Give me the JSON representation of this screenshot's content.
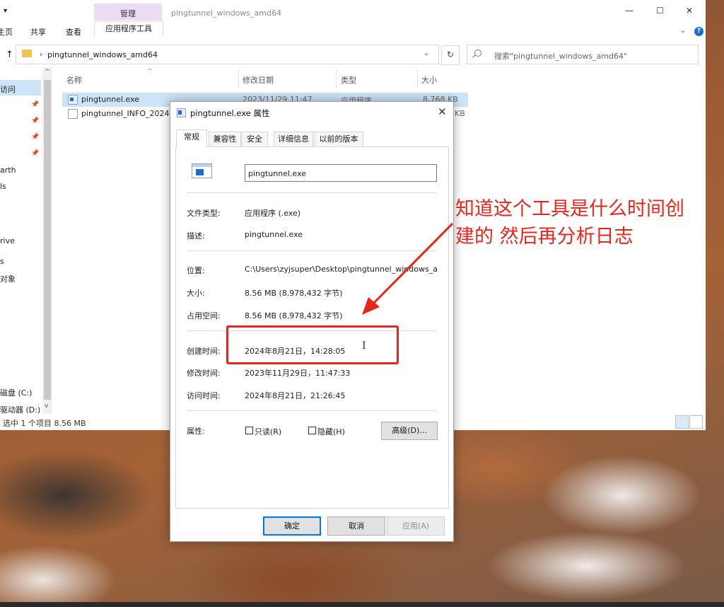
{
  "explorer": {
    "window_title": "pingtunnel_windows_amd64",
    "context_tab_group": "管理",
    "ribbon_tabs": [
      "主页",
      "共享",
      "查看",
      "应用程序工具"
    ],
    "breadcrumb": "pingtunnel_windows_amd64",
    "search_placeholder": "搜索\"pingtunnel_windows_amd64\"",
    "nav_items": [
      "访问",
      "arth",
      "ls",
      "rive",
      "s",
      "对象",
      "磁盘 (C:)",
      "驱动器 (D:)"
    ],
    "columns": [
      "名称",
      "修改日期",
      "类型",
      "大小"
    ],
    "files": [
      {
        "name": "pingtunnel.exe",
        "modified": "2023/11/29 11:47",
        "type": "应用程序",
        "size": "8,768 KB"
      },
      {
        "name": "pingtunnel_INFO_2024",
        "modified": "",
        "type": "",
        "size": "KB"
      }
    ],
    "status": "选中 1 个项目  8.56 MB"
  },
  "dialog": {
    "title": "pingtunnel.exe 属性",
    "tabs": [
      "常规",
      "兼容性",
      "安全",
      "详细信息",
      "以前的版本"
    ],
    "filename": "pingtunnel.exe",
    "props": {
      "type_label": "文件类型:",
      "type_value": "应用程序 (.exe)",
      "desc_label": "描述:",
      "desc_value": "pingtunnel.exe",
      "location_label": "位置:",
      "location_value": "C:\\Users\\zyjsuper\\Desktop\\pingtunnel_windows_a",
      "size_label": "大小:",
      "size_value": "8.56 MB (8,978,432 字节)",
      "disk_label": "占用空间:",
      "disk_value": "8.56 MB (8,978,432 字节)",
      "created_label": "创建时间:",
      "created_value": "2024年8月21日，14:28:05",
      "modified_label": "修改时间:",
      "modified_value": "2023年11月29日，11:47:33",
      "accessed_label": "访问时间:",
      "accessed_value": "2024年8月21日，21:26:45",
      "attr_label": "属性:",
      "readonly_label": "只读(R)",
      "hidden_label": "隐藏(H)",
      "advanced_label": "高级(D)..."
    },
    "buttons": {
      "ok": "确定",
      "cancel": "取消",
      "apply": "应用(A)"
    }
  },
  "annotation": {
    "text_line1": "知道这个工具是什么时间创",
    "text_line2": "建的 然后再分析日志",
    "color": "#e8251b"
  },
  "colors": {
    "selection": "#cce4f7",
    "context_tab": "#eadcf2",
    "accent": "#0078d7"
  }
}
